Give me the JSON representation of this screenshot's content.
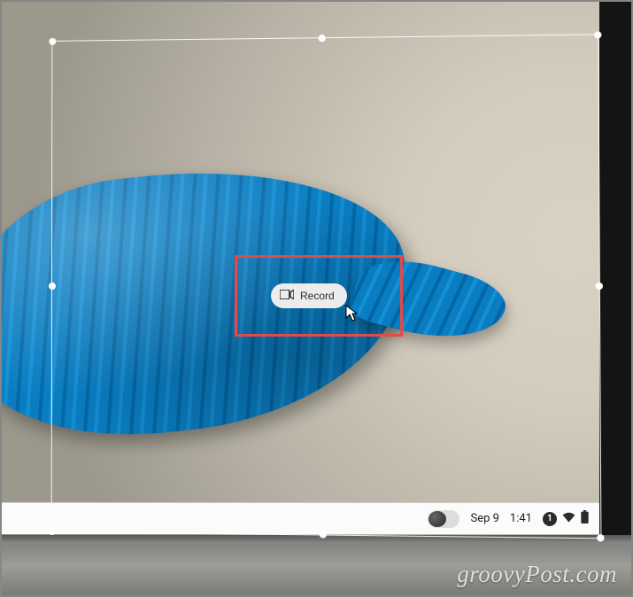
{
  "record_button": {
    "label": "Record"
  },
  "taskbar": {
    "date": "Sep 9",
    "time": "1:41",
    "notification_count": "1"
  },
  "watermark": "groovyPost.com",
  "colors": {
    "highlight": "#e44a47"
  }
}
